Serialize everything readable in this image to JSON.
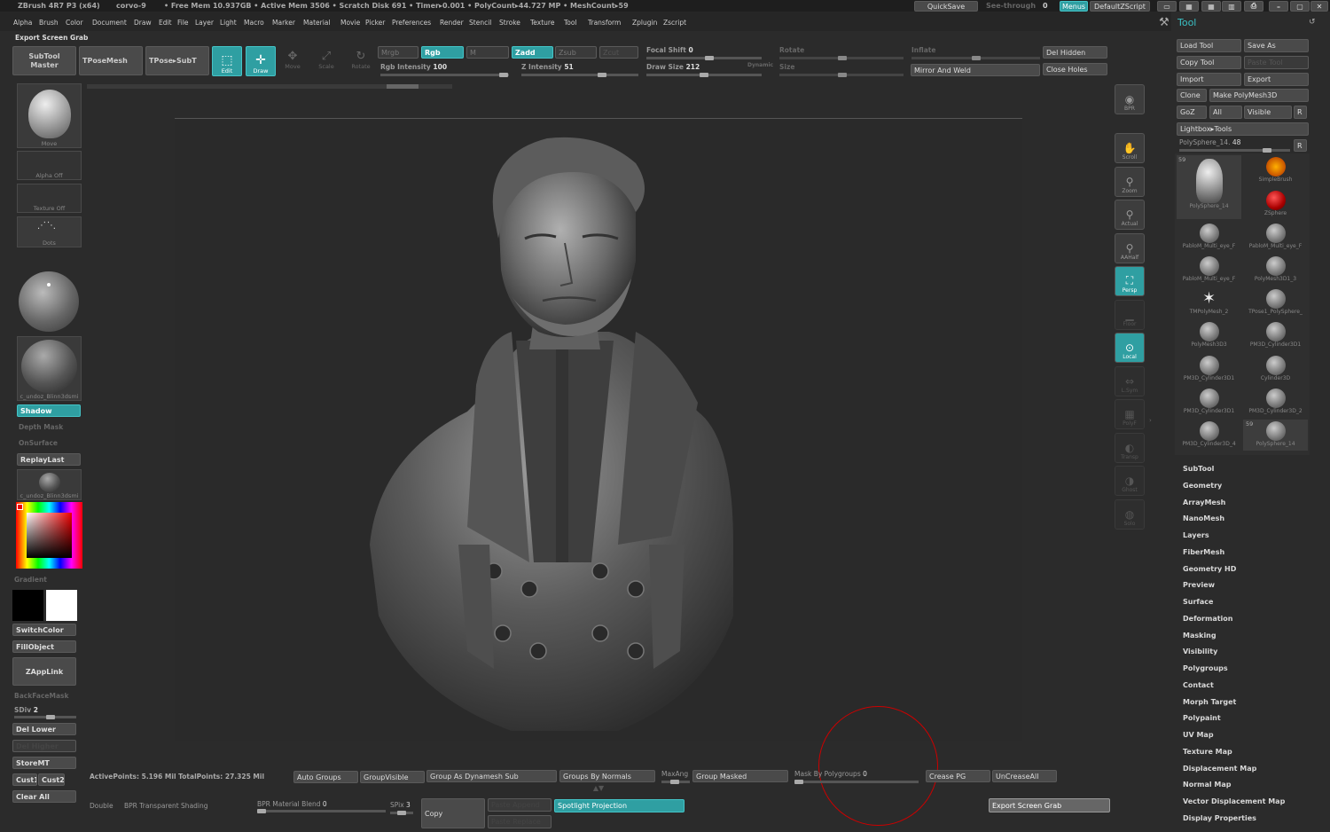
{
  "titlebar": {
    "app": "ZBrush 4R7 P3 (x64)",
    "doc": "corvo-9",
    "stats": "• Free Mem 10.937GB • Active Mem 3506 • Scratch Disk 691 • Timer▸0.001 • PolyCount▸44.727 MP • MeshCount▸59",
    "quicksave": "QuickSave",
    "seethrough": "See-through",
    "seethrough_val": "0",
    "menus": "Menus",
    "defaultzscript": "DefaultZScript"
  },
  "menu": [
    "Alpha",
    "Brush",
    "Color",
    "Document",
    "Draw",
    "Edit",
    "File",
    "Layer",
    "Light",
    "Macro",
    "Marker",
    "Material",
    "Movie",
    "Picker",
    "Preferences",
    "Render",
    "Stencil",
    "Stroke",
    "Texture",
    "Tool",
    "Transform",
    "Zplugin",
    "Zscript"
  ],
  "subheader": "Export Screen Grab",
  "toolbar": {
    "subtool_master_1": "SubTool",
    "subtool_master_2": "Master",
    "tposemesh": "TPoseMesh",
    "tpose_subt": "TPose▸SubT",
    "edit": "Edit",
    "draw": "Draw",
    "move": "Move",
    "scale": "Scale",
    "rotate": "Rotate",
    "mrgb": "Mrgb",
    "rgb": "Rgb",
    "m": "M",
    "zadd": "Zadd",
    "zsub": "Zsub",
    "zcut": "Zcut",
    "rgb_intensity": "Rgb Intensity",
    "rgb_intensity_val": "100",
    "z_intensity": "Z Intensity",
    "z_intensity_val": "51",
    "focal_shift": "Focal Shift",
    "focal_shift_val": "0",
    "draw_size": "Draw Size",
    "draw_size_val": "212",
    "dynamic": "Dynamic",
    "rotate2": "Rotate",
    "size": "Size",
    "inflate": "Inflate",
    "mirror_weld": "Mirror And Weld",
    "del_hidden": "Del Hidden",
    "close_holes": "Close Holes"
  },
  "left": {
    "move": "Move",
    "alpha_off": "Alpha Off",
    "texture_off": "Texture Off",
    "dots": "Dots",
    "mat_name": "c_undoz_Blinn3dsmi",
    "shadow": "Shadow",
    "depth_mask": "Depth Mask",
    "onsurface": "OnSurface",
    "replaylast": "ReplayLast",
    "mat_name2": "c_undoz_Blinn3dsmi",
    "gradient": "Gradient",
    "switchcolor": "SwitchColor",
    "fillobject": "FillObject",
    "zapplink": "ZAppLink",
    "backfacemask": "BackFaceMask",
    "sdiv": "SDiv",
    "sdiv_val": "2",
    "del_lower": "Del Lower",
    "del_higher": "Del Higher",
    "storemt": "StoreMT",
    "cust1": "Cust1",
    "cust2": "Cust2",
    "clear_all": "Clear All"
  },
  "viewbar": [
    {
      "label": "BPR",
      "on": false,
      "dim": false
    },
    {
      "label": "Scroll",
      "on": false,
      "dim": false
    },
    {
      "label": "Zoom",
      "on": false,
      "dim": false
    },
    {
      "label": "Actual",
      "on": false,
      "dim": false
    },
    {
      "label": "AAHalf",
      "on": false,
      "dim": false
    },
    {
      "label": "Persp",
      "on": true,
      "dim": false
    },
    {
      "label": "Floor",
      "on": false,
      "dim": true
    },
    {
      "label": "Local",
      "on": true,
      "dim": false
    },
    {
      "label": "L.Sym",
      "on": false,
      "dim": true
    },
    {
      "label": "PolyF",
      "on": false,
      "dim": true
    },
    {
      "label": "Transp",
      "on": false,
      "dim": true
    },
    {
      "label": "Ghost",
      "on": false,
      "dim": true
    },
    {
      "label": "Solo",
      "on": false,
      "dim": true
    }
  ],
  "bottom": {
    "activepoints": "ActivePoints: 5.196 Mil TotalPoints: 27.325 Mil",
    "auto_groups": "Auto Groups",
    "groupvisible": "GroupVisible",
    "group_dyn_sub": "Group As Dynamesh Sub",
    "groups_by_normals": "Groups By Normals",
    "maxang": "MaxAng",
    "group_masked": "Group Masked",
    "mask_by_polygroups": "Mask By Polygroups",
    "mask_by_polygroups_val": "0",
    "crease_pg": "Crease PG",
    "uncreaseall": "UnCreaseAll",
    "double": "Double",
    "bpr_transparent": "BPR Transparent Shading",
    "bpr_material_blend": "BPR Material Blend",
    "bpr_material_blend_val": "0",
    "spix": "SPix",
    "spix_val": "3",
    "copy": "Copy",
    "paste_append": "Paste Append",
    "paste_replace": "Paste Replace",
    "spotlight_projection": "Spotlight Projection",
    "export_screen_grab": "Export Screen Grab"
  },
  "right": {
    "title": "Tool",
    "load_tool": "Load Tool",
    "save_as": "Save As",
    "copy_tool": "Copy Tool",
    "paste_tool": "Paste Tool",
    "import": "Import",
    "export": "Export",
    "clone": "Clone",
    "make_polymesh": "Make PolyMesh3D",
    "goz": "GoZ",
    "all": "All",
    "visible": "Visible",
    "r": "R",
    "lightbox_tools": "Lightbox▸Tools",
    "current_tool": "PolySphere_14.",
    "current_tool_val": "48",
    "thumbs": [
      {
        "name": "PolySphere_14",
        "badge": "59"
      },
      {
        "name": "SimpleBrush",
        "badge": ""
      },
      {
        "name": "ZSphere",
        "badge": ""
      },
      {
        "name": "PabloM_Multi_eye_F",
        "badge": ""
      },
      {
        "name": "PabloM_Multi_eye_F",
        "badge": ""
      },
      {
        "name": "PabloM_Multi_eye_F",
        "badge": ""
      },
      {
        "name": "PolyMesh3D1_3",
        "badge": ""
      },
      {
        "name": "TMPolyMesh_2",
        "badge": ""
      },
      {
        "name": "TPose1_PolySphere_",
        "badge": ""
      },
      {
        "name": "PolyMesh3D3",
        "badge": ""
      },
      {
        "name": "PM3D_Cylinder3D1",
        "badge": ""
      },
      {
        "name": "PM3D_Cylinder3D1",
        "badge": ""
      },
      {
        "name": "Cylinder3D",
        "badge": ""
      },
      {
        "name": "PM3D_Cylinder3D1",
        "badge": ""
      },
      {
        "name": "PM3D_Cylinder3D_2",
        "badge": ""
      },
      {
        "name": "PM3D_Cylinder3D_4",
        "badge": ""
      },
      {
        "name": "PolySphere_14",
        "badge": "59"
      }
    ],
    "sections": [
      "SubTool",
      "Geometry",
      "ArrayMesh",
      "NanoMesh",
      "Layers",
      "FiberMesh",
      "Geometry HD",
      "Preview",
      "Surface",
      "Deformation",
      "Masking",
      "Visibility",
      "Polygroups",
      "Contact",
      "Morph Target",
      "Polypaint",
      "UV Map",
      "Texture Map",
      "Displacement Map",
      "Normal Map",
      "Vector Displacement Map",
      "Display Properties"
    ]
  },
  "colors": {
    "accent": "#2f9fa2",
    "bg": "#2b2b2b",
    "panel": "#3a3a3a"
  }
}
